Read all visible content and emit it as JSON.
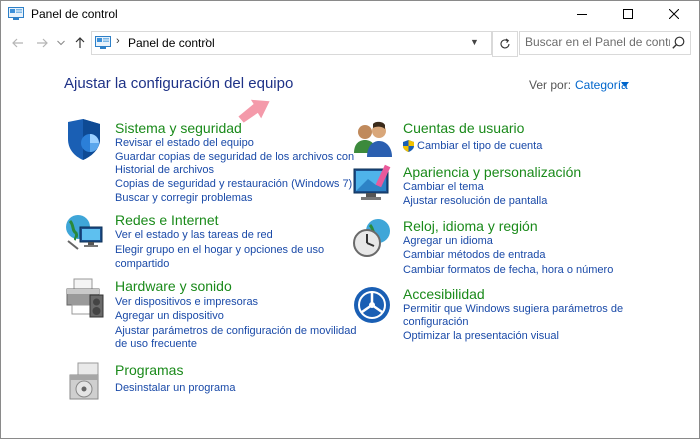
{
  "window": {
    "title": "Panel de control",
    "controls": [
      "minimize",
      "maximize",
      "close"
    ]
  },
  "addressbar": {
    "crumb": "Panel de control",
    "search_placeholder": "Buscar en el Panel de control"
  },
  "page": {
    "title": "Ajustar la configuración del equipo",
    "view_by_label": "Ver por:",
    "view_by_value": "Categoría"
  },
  "categories": {
    "sistema": {
      "title": "Sistema y seguridad",
      "icon": "shield-icon",
      "links": [
        "Revisar el estado del equipo",
        "Guardar copias de seguridad de los archivos con",
        "Historial de archivos",
        "Copias de seguridad y restauración (Windows 7)",
        "Buscar y corregir problemas"
      ]
    },
    "redes": {
      "title": "Redes e Internet",
      "icon": "network-globe-icon",
      "links": [
        "Ver el estado y las tareas de red",
        "Elegir grupo en el hogar y opciones de uso",
        "compartido"
      ]
    },
    "hardware": {
      "title": "Hardware y sonido",
      "icon": "printer-icon",
      "links": [
        "Ver dispositivos e impresoras",
        "Agregar un dispositivo",
        "Ajustar parámetros de configuración de movilidad",
        "de uso frecuente"
      ]
    },
    "programas": {
      "title": "Programas",
      "icon": "programs-disk-icon",
      "links": [
        "Desinstalar un programa"
      ]
    },
    "cuentas": {
      "title": "Cuentas de usuario",
      "icon": "users-icon",
      "links": [
        "Cambiar el tipo de cuenta"
      ]
    },
    "apariencia": {
      "title": "Apariencia y personalización",
      "icon": "monitor-paint-icon",
      "links": [
        "Cambiar el tema",
        "Ajustar resolución de pantalla"
      ]
    },
    "reloj": {
      "title": "Reloj, idioma y región",
      "icon": "clock-globe-icon",
      "links": [
        "Agregar un idioma",
        "Cambiar métodos de entrada",
        "Cambiar formatos de fecha, hora o número"
      ]
    },
    "accesibilidad": {
      "title": "Accesibilidad",
      "icon": "accessibility-icon",
      "links": [
        "Permitir que Windows sugiera parámetros de",
        "configuración",
        "Optimizar la presentación visual"
      ]
    }
  },
  "colors": {
    "category_title": "#1a8a1a",
    "link": "#1a4aa8",
    "page_title": "#1e3287",
    "annotation_arrow": "#f49aaa"
  }
}
